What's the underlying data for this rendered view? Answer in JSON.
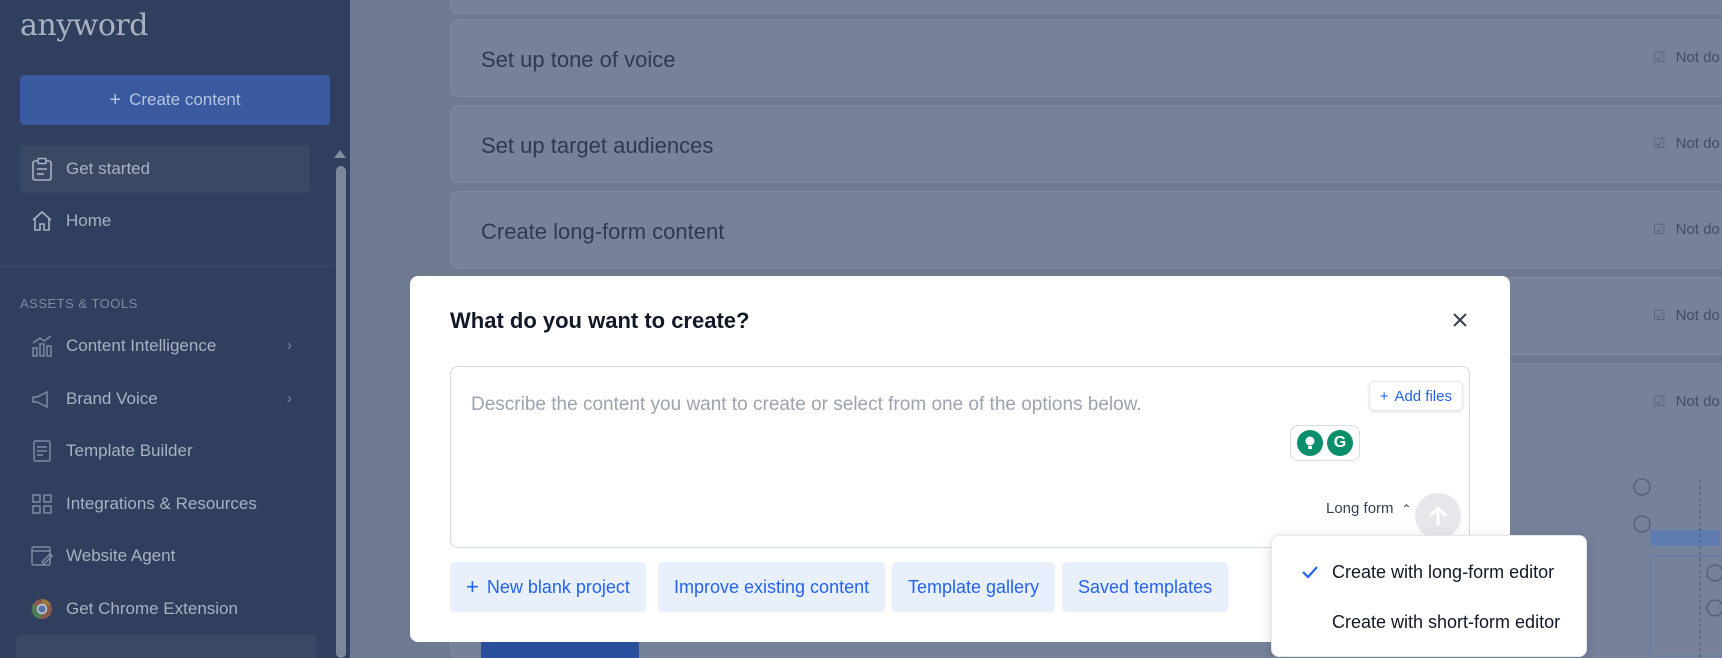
{
  "app": {
    "logo": "anyword"
  },
  "sidebar": {
    "create_label": "Create content",
    "get_started": "Get started",
    "home": "Home",
    "section_label": "ASSETS & TOOLS",
    "items": [
      {
        "label": "Content Intelligence",
        "icon": "chart-icon",
        "has_chevron": true
      },
      {
        "label": "Brand Voice",
        "icon": "megaphone-icon",
        "has_chevron": true
      },
      {
        "label": "Template Builder",
        "icon": "template-icon",
        "has_chevron": false
      },
      {
        "label": "Integrations & Resources",
        "icon": "grid-icon",
        "has_chevron": false
      },
      {
        "label": "Website Agent",
        "icon": "website-agent-icon",
        "has_chevron": false
      },
      {
        "label": "Get Chrome Extension",
        "icon": "chrome-icon",
        "has_chevron": false
      }
    ]
  },
  "main": {
    "tasks": [
      {
        "title": "Set up tone of voice",
        "status": "Not do"
      },
      {
        "title": "Set up target audiences",
        "status": "Not do"
      },
      {
        "title": "Create long-form content",
        "status": "Not do"
      },
      {
        "title": "",
        "status": "Not do"
      },
      {
        "title": "",
        "status": "Not do"
      }
    ]
  },
  "modal": {
    "title": "What do you want to create?",
    "placeholder": "Describe the content you want to create or select from one of the options below.",
    "add_files": "Add files",
    "form_type": "Long form",
    "chips": {
      "new_blank": "New blank project",
      "improve": "Improve existing content",
      "gallery": "Template gallery",
      "saved": "Saved templates"
    }
  },
  "dropdown": {
    "options": [
      {
        "label": "Create with long-form editor",
        "selected": true
      },
      {
        "label": "Create with short-form editor",
        "selected": false
      }
    ]
  },
  "colors": {
    "accent": "#2563eb",
    "sidebar_bg": "#2f3f5d",
    "overlay_bg": "#6e7a92",
    "grammarly": "#0b8f6b"
  }
}
